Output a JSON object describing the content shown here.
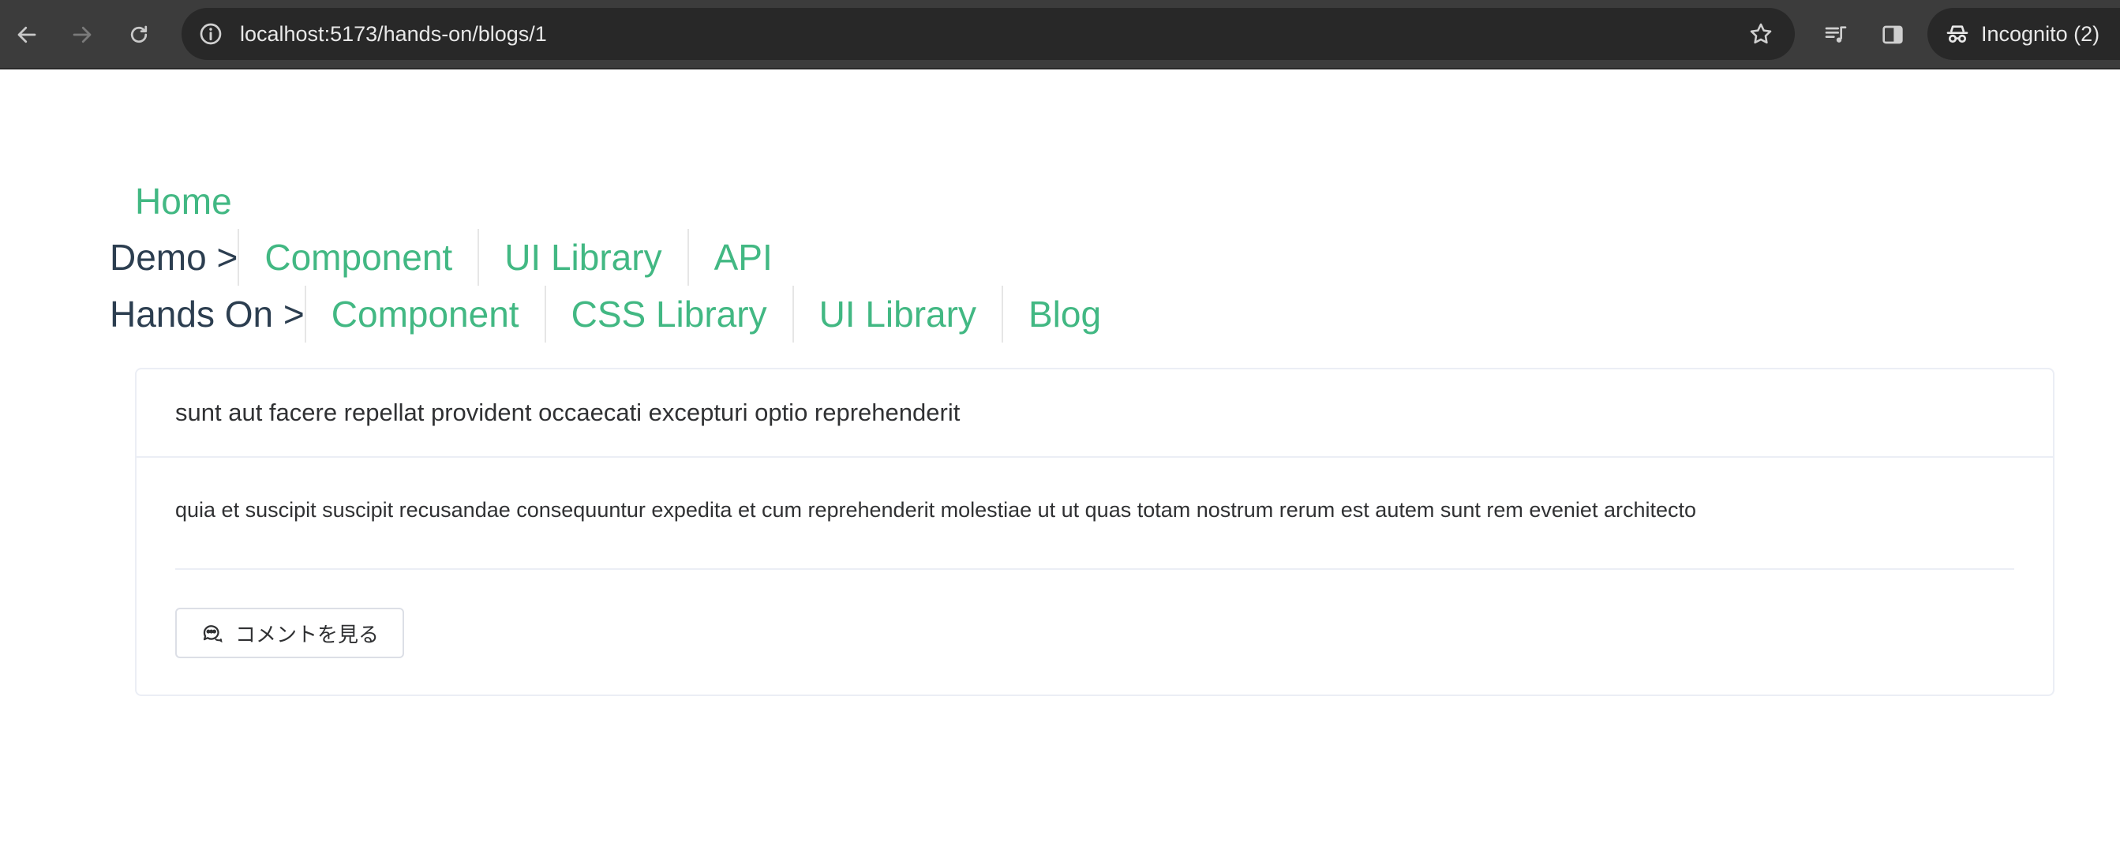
{
  "browser": {
    "url": "localhost:5173/hands-on/blogs/1",
    "profile_label": "Incognito (2)"
  },
  "nav": {
    "home": "Home",
    "demo": {
      "prefix": "Demo >",
      "links": [
        "Component",
        "UI Library",
        "API"
      ]
    },
    "hands_on": {
      "prefix": "Hands On >",
      "links": [
        "Component",
        "CSS Library",
        "UI Library",
        "Blog"
      ]
    },
    "link_color": "#42b883"
  },
  "post": {
    "title": "sunt aut facere repellat provident occaecati excepturi optio reprehenderit",
    "body": "quia et suscipit suscipit recusandae consequuntur expedita et cum reprehenderit molestiae ut ut quas totam nostrum rerum est autem sunt rem eveniet architecto",
    "comment_button": "コメントを見る"
  }
}
